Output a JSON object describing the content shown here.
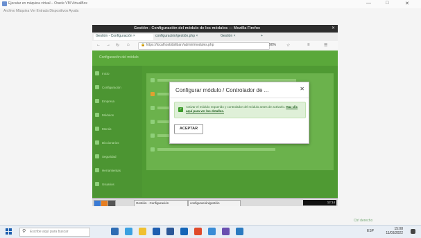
{
  "host": {
    "title": "Ejecutar en máquina virtual – Oracle VM VirtualBox",
    "menu": "Archivo  Máquina  Ver  Entrada  Dispositivos  Ayuda",
    "status": "Ctrl derecho"
  },
  "vm": {
    "window_title": "Gestión - Configuración del módulo de los módulos — Mozilla Firefox",
    "tabs": [
      {
        "label": "Gestión - Configuración"
      },
      {
        "label": "configuración/gestión.php"
      },
      {
        "label": "Gestión"
      }
    ],
    "url": "https://localhost/dolibarr/admin/modules.php",
    "zoom": "90%",
    "app_header": "Configuración del módulo",
    "sidebar": [
      {
        "label": "Inicio"
      },
      {
        "label": "Configuración"
      },
      {
        "label": "Empresa"
      },
      {
        "label": "Módulos"
      },
      {
        "label": "Menús"
      },
      {
        "label": "Diccionarios"
      },
      {
        "label": "Seguridad"
      },
      {
        "label": "Herramientas"
      },
      {
        "label": "Usuarios"
      }
    ],
    "modal": {
      "title": "Configurar módulo / Controlador de ...",
      "message": "Activar el módulo requerido y controlador del módulo antes de activarlo.",
      "link": "Haz clic aquí para ver los detalles.",
      "accept": "ACEPTAR"
    },
    "taskbar": [
      {
        "label": "Gestión - Configuración"
      },
      {
        "label": "configuración/gestión"
      }
    ],
    "clock": "12:14"
  },
  "taskbar": {
    "search_placeholder": "Escribe aquí para buscar",
    "time": "15:08",
    "date": "11/03/2022",
    "tray": "ESP"
  },
  "colors": {
    "app_green": "#4f9a33",
    "alert_bg": "#dff0d8"
  }
}
